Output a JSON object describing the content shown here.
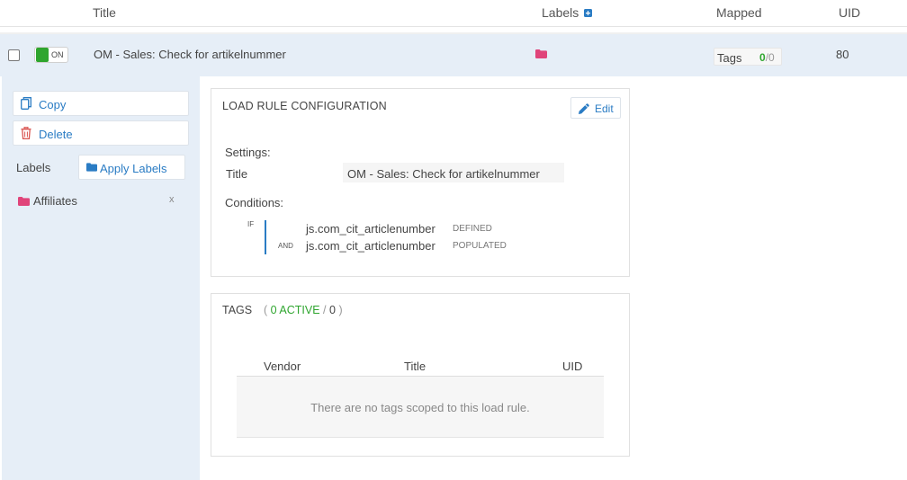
{
  "columns": {
    "title": "Title",
    "labels": "Labels",
    "mapped": "Mapped",
    "uid": "UID"
  },
  "rule": {
    "toggle": "ON",
    "title": "OM - Sales: Check for artikelnummer",
    "mapped_label": "Tags",
    "mapped_active": "0",
    "mapped_total": "/0",
    "uid": "80"
  },
  "sidebar": {
    "copy": "Copy",
    "delete": "Delete",
    "labels_heading": "Labels",
    "apply_labels": "Apply Labels",
    "label_name": "Affiliates",
    "remove": "x"
  },
  "config": {
    "heading": "LOAD RULE CONFIGURATION",
    "edit": "Edit",
    "settings_heading": "Settings:",
    "title_key": "Title",
    "title_value": "OM - Sales: Check for artikelnummer",
    "conditions_heading": "Conditions:",
    "if": "IF",
    "and": "AND",
    "conditions": [
      {
        "variable": "js.com_cit_articlenumber",
        "operator": "DEFINED"
      },
      {
        "variable": "js.com_cit_articlenumber",
        "operator": "POPULATED"
      }
    ]
  },
  "tags": {
    "heading": "TAGS",
    "open": "(",
    "active": "0 ACTIVE",
    "sep": "/",
    "total": "0",
    "close": ")",
    "columns": {
      "vendor": "Vendor",
      "title": "Title",
      "uid": "UID"
    },
    "empty_message": "There are no tags scoped to this load rule."
  },
  "colors": {
    "accent": "#2a7cc4",
    "on_green": "#2ea52e",
    "label_pink": "#e0447a",
    "delete_red": "#d9534f",
    "row_highlight": "#e6eef7"
  }
}
